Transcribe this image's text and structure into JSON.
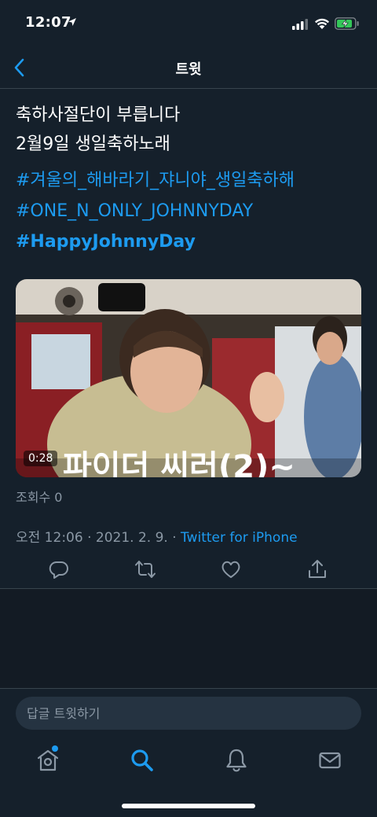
{
  "status_bar": {
    "time": "12:07"
  },
  "nav": {
    "title": "트윗"
  },
  "tweet": {
    "lines": [
      "축하사절단이 부릅니다",
      "2월9일 생일축하노래"
    ],
    "hashtags": [
      "#겨울의_해바라기_쟈니야_생일축하해",
      "#ONE_N_ONLY_JOHNNYDAY",
      "#HappyJohnnyDay"
    ],
    "video": {
      "duration": "0:28",
      "caption": "파이더 씨러(2)~"
    },
    "view_count": "조회수 0",
    "timestamp": "오전 12:06 · 2021. 2. 9. · ",
    "source": "Twitter for iPhone"
  },
  "actions": [
    "reply-icon",
    "retweet-icon",
    "like-icon",
    "share-icon"
  ],
  "reply": {
    "placeholder": "답글 트윗하기"
  },
  "tabs": [
    "home-icon",
    "search-icon",
    "notifications-icon",
    "messages-icon"
  ],
  "colors": {
    "background": "#15202b",
    "accent": "#1d9bf0",
    "secondary_text": "#8b98a5",
    "divider": "#38444d"
  }
}
